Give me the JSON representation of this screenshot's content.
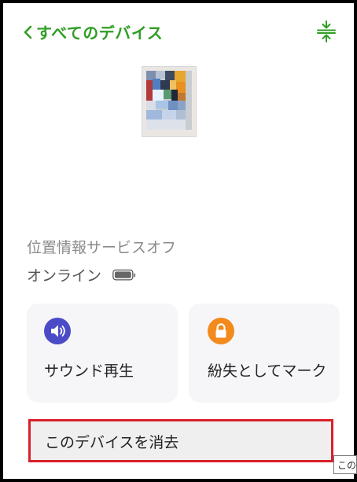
{
  "header": {
    "back_label": "すべてのデバイス",
    "back_icon": "chevron-left-icon",
    "collapse_icon": "collapse-vertical-icon",
    "accent_color": "#2f9e23"
  },
  "device": {
    "location_status": "位置情報サービスオフ",
    "online_status": "オンライン",
    "battery_icon": "battery-icon"
  },
  "actions": {
    "play_sound": {
      "label": "サウンド再生",
      "icon": "speaker-icon",
      "icon_color": "#4b4bc8"
    },
    "mark_lost": {
      "label": "紛失としてマーク",
      "icon": "lock-icon",
      "icon_color": "#f28a1c"
    },
    "erase": {
      "label": "このデバイスを消去",
      "highlight_color": "#d8202a"
    }
  },
  "tooltip": {
    "text": "このデバイスを消去"
  }
}
